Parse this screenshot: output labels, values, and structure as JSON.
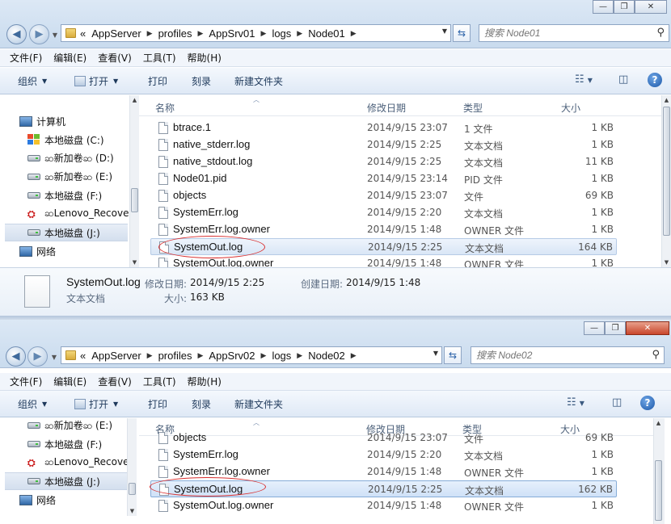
{
  "top": {
    "breadcrumb": [
      "AppServer",
      "profiles",
      "AppSrv01",
      "logs",
      "Node01"
    ],
    "back_glyph": "«",
    "search_placeholder": "搜索 Node01",
    "menu": [
      "文件(F)",
      "编辑(E)",
      "查看(V)",
      "工具(T)",
      "帮助(H)"
    ],
    "commands": {
      "organize": "组织",
      "open": "打开",
      "print": "打印",
      "burn": "刻录",
      "new_folder": "新建文件夹"
    },
    "nav": [
      {
        "label": "计算机",
        "icon": "computer-icon"
      },
      {
        "label": "本地磁盘 (C:)",
        "icon": "windows-drive-icon"
      },
      {
        "label": "ဆ新加卷ဆ (D:)",
        "icon": "drive-icon"
      },
      {
        "label": "ဆ新加卷ဆ (E:)",
        "icon": "drive-icon"
      },
      {
        "label": "本地磁盘 (F:)",
        "icon": "drive-icon"
      },
      {
        "label": "ဆLenovo_Recover",
        "icon": "lenovo-drive-icon"
      },
      {
        "label": "本地磁盘 (J:)",
        "icon": "drive-icon",
        "selected": true
      },
      {
        "label": "网络",
        "icon": "network-icon"
      }
    ],
    "columns": {
      "name": "名称",
      "date": "修改日期",
      "type": "类型",
      "size": "大小"
    },
    "files": [
      {
        "name": "btrace.1",
        "date": "2014/9/15 23:07",
        "type": "1 文件",
        "size": "1 KB"
      },
      {
        "name": "native_stderr.log",
        "date": "2014/9/15 2:25",
        "type": "文本文档",
        "size": "1 KB"
      },
      {
        "name": "native_stdout.log",
        "date": "2014/9/15 2:25",
        "type": "文本文档",
        "size": "11 KB"
      },
      {
        "name": "Node01.pid",
        "date": "2014/9/15 23:14",
        "type": "PID 文件",
        "size": "1 KB"
      },
      {
        "name": "objects",
        "date": "2014/9/15 23:07",
        "type": "文件",
        "size": "69 KB"
      },
      {
        "name": "SystemErr.log",
        "date": "2014/9/15 2:20",
        "type": "文本文档",
        "size": "1 KB"
      },
      {
        "name": "SystemErr.log.owner",
        "date": "2014/9/15 1:48",
        "type": "OWNER 文件",
        "size": "1 KB"
      },
      {
        "name": "SystemOut.log",
        "date": "2014/9/15 2:25",
        "type": "文本文档",
        "size": "164 KB",
        "selected": true
      },
      {
        "name": "SystemOut.log.owner",
        "date": "2014/9/15 1:48",
        "type": "OWNER 文件",
        "size": "1 KB"
      }
    ],
    "details": {
      "filename": "SystemOut.log",
      "filetype": "文本文档",
      "modified_label": "修改日期:",
      "modified": "2014/9/15 2:25",
      "created_label": "创建日期:",
      "created": "2014/9/15 1:48",
      "size_label": "大小:",
      "size": "163 KB"
    }
  },
  "bottom": {
    "breadcrumb": [
      "AppServer",
      "profiles",
      "AppSrv02",
      "logs",
      "Node02"
    ],
    "search_placeholder": "搜索 Node02",
    "menu": [
      "文件(F)",
      "编辑(E)",
      "查看(V)",
      "工具(T)",
      "帮助(H)"
    ],
    "commands": {
      "organize": "组织",
      "open": "打开",
      "print": "打印",
      "burn": "刻录",
      "new_folder": "新建文件夹"
    },
    "nav": [
      {
        "label": "ဆ新加卷ဆ (E:)",
        "icon": "drive-icon"
      },
      {
        "label": "本地磁盘 (F:)",
        "icon": "drive-icon"
      },
      {
        "label": "ဆLenovo_Recover",
        "icon": "lenovo-drive-icon"
      },
      {
        "label": "本地磁盘 (J:)",
        "icon": "drive-icon",
        "selected": true
      },
      {
        "label": "网络",
        "icon": "network-icon"
      }
    ],
    "columns": {
      "name": "名称",
      "date": "修改日期",
      "type": "类型",
      "size": "大小"
    },
    "files": [
      {
        "name": "objects",
        "date": "2014/9/15 23:07",
        "type": "文件",
        "size": "69 KB"
      },
      {
        "name": "SystemErr.log",
        "date": "2014/9/15 2:20",
        "type": "文本文档",
        "size": "1 KB"
      },
      {
        "name": "SystemErr.log.owner",
        "date": "2014/9/15 1:48",
        "type": "OWNER 文件",
        "size": "1 KB"
      },
      {
        "name": "SystemOut.log",
        "date": "2014/9/15 2:25",
        "type": "文本文档",
        "size": "162 KB",
        "selected": true
      },
      {
        "name": "SystemOut.log.owner",
        "date": "2014/9/15 1:48",
        "type": "OWNER 文件",
        "size": "1 KB"
      }
    ]
  },
  "colors": {
    "highlight_ellipse": "#d93030",
    "selection": "#cfe1f7",
    "chrome": "#c9dbee"
  }
}
